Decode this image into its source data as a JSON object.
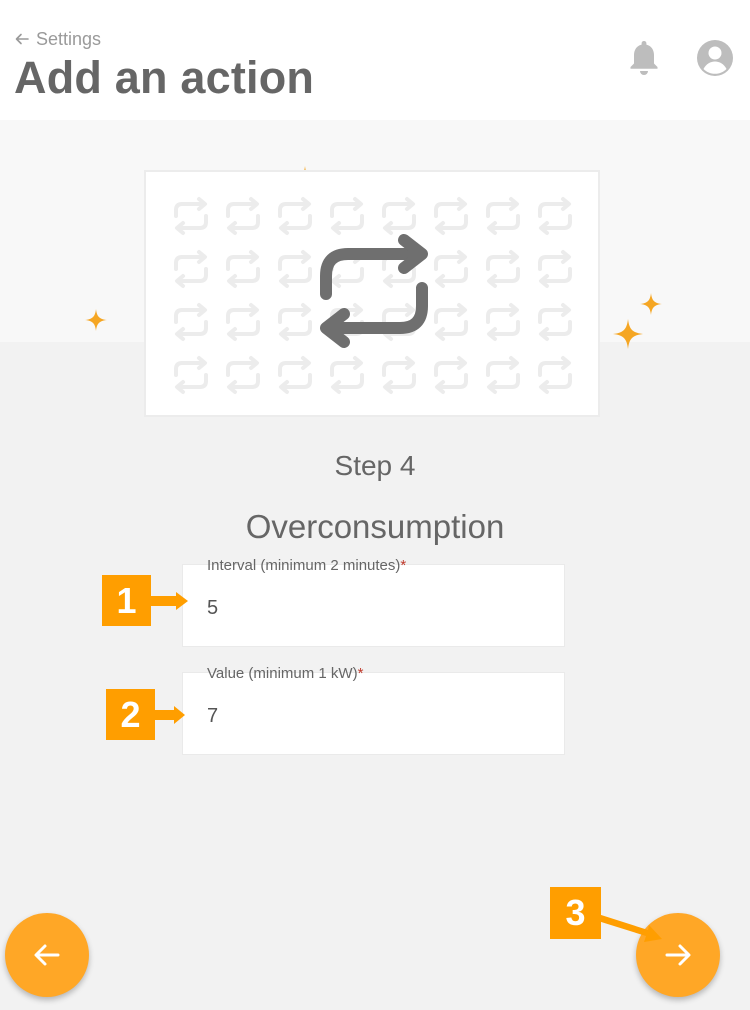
{
  "header": {
    "back_label": "Settings",
    "title": "Add an action",
    "icons": [
      "arrow-left-icon",
      "bell-icon",
      "user-avatar-icon"
    ]
  },
  "illustration": {
    "icon": "repeat-icon",
    "pattern_icon": "repeat-icon"
  },
  "step": {
    "label": "Step 4",
    "title": "Overconsumption"
  },
  "form": {
    "interval": {
      "label": "Interval (minimum 2 minutes)",
      "required_mark": "*",
      "value": "5"
    },
    "value": {
      "label": "Value (minimum 1 kW)",
      "required_mark": "*",
      "value": "7"
    }
  },
  "annotations": {
    "marker_1": "1",
    "marker_2": "2",
    "marker_3": "3"
  },
  "navigation": {
    "back_icon": "arrow-left-icon",
    "next_icon": "arrow-right-icon"
  },
  "colors": {
    "accent": "#ffa726",
    "marker": "#ff9e00",
    "sparkle": "#f5a623",
    "text": "#666666",
    "required": "#c0392b"
  }
}
